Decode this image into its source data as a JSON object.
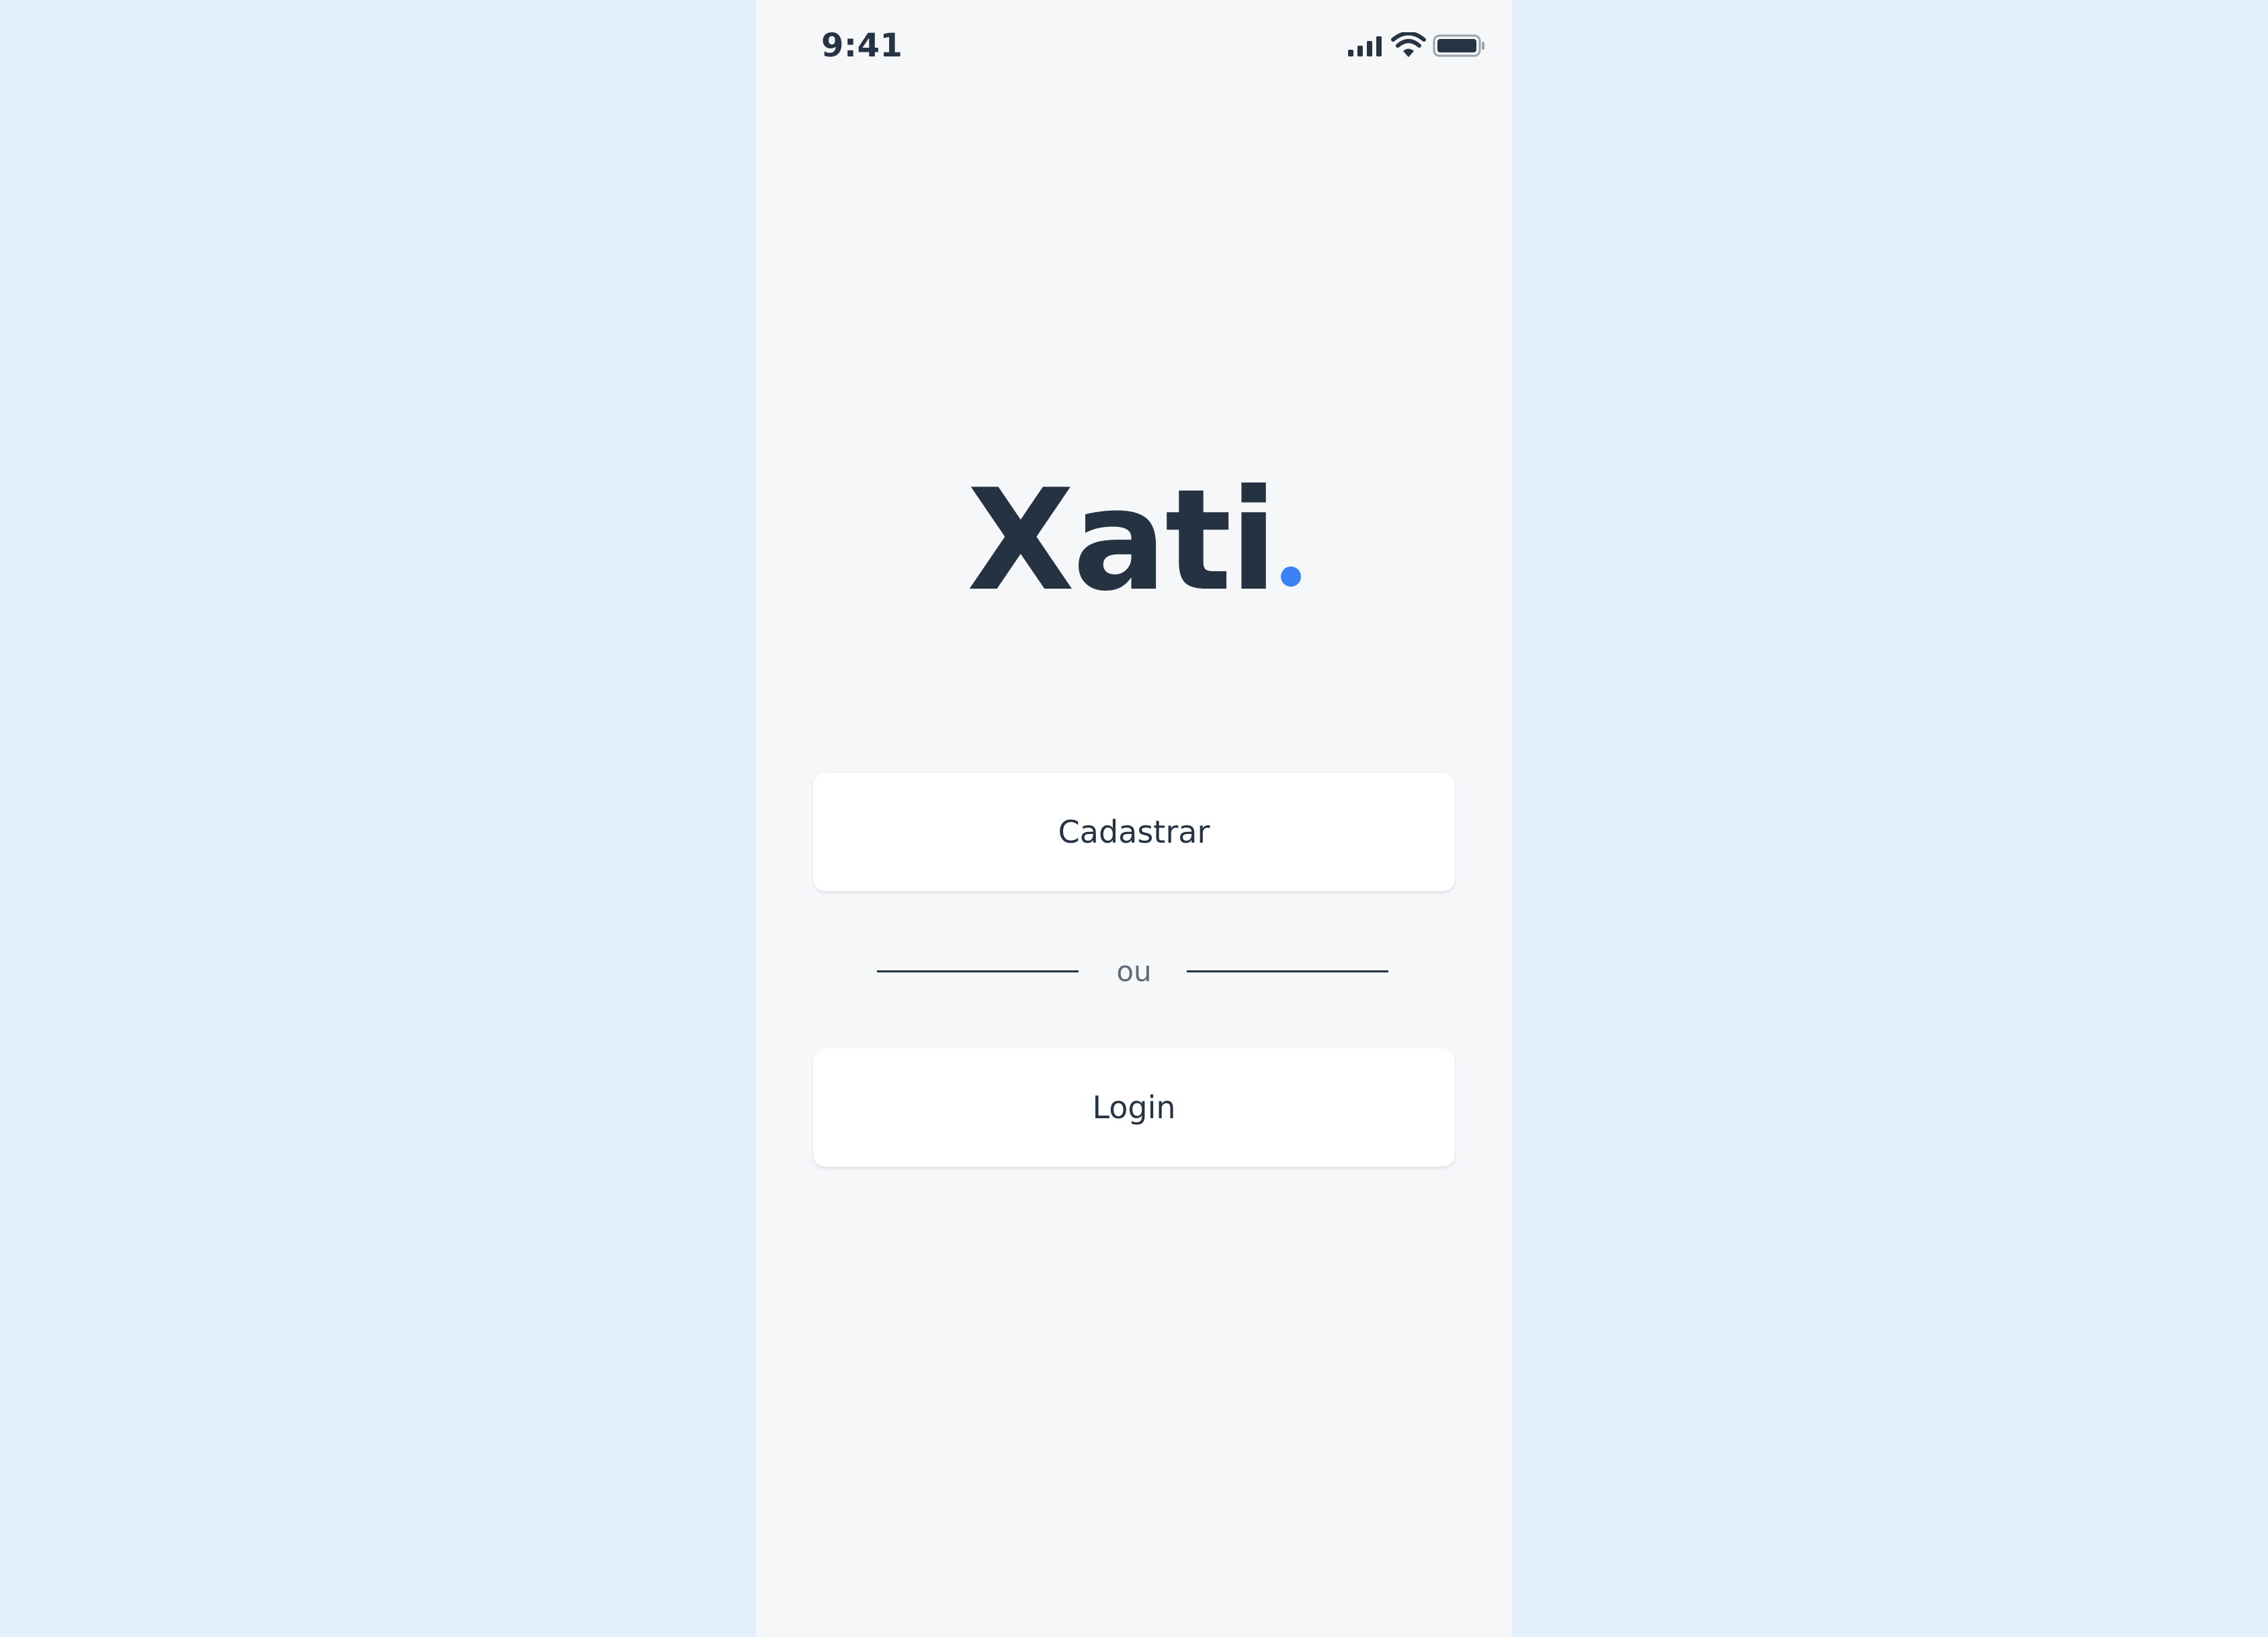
{
  "status_bar": {
    "time": "9:41",
    "icons": [
      "cellular-signal-icon",
      "wifi-icon",
      "battery-icon"
    ]
  },
  "logo": {
    "text": "Xati",
    "dot_color": "#3b82f6"
  },
  "actions": {
    "register_label": "Cadastrar",
    "divider_label": "ou",
    "login_label": "Login"
  },
  "colors": {
    "background": "#e4f0fe",
    "screen": "#f6f7f9",
    "text": "#253343",
    "accent": "#3b82f6"
  }
}
